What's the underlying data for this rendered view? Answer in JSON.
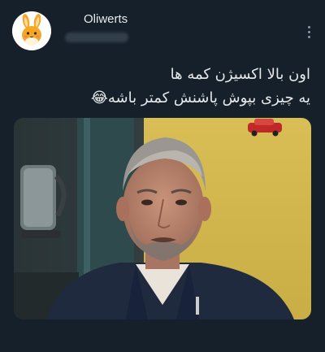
{
  "tweet": {
    "display_name": "Oliwerts",
    "text_lines": [
      "اون بالا اکسیژن کمه ها",
      "یه چیزی بپوش پاشنش کمتر باشه😂"
    ]
  },
  "colors": {
    "background": "#15202b",
    "text": "#e7e9ea",
    "muted": "#8b98a5"
  },
  "icons": {
    "more": "more-options-icon",
    "avatar": "bunny-avatar"
  }
}
